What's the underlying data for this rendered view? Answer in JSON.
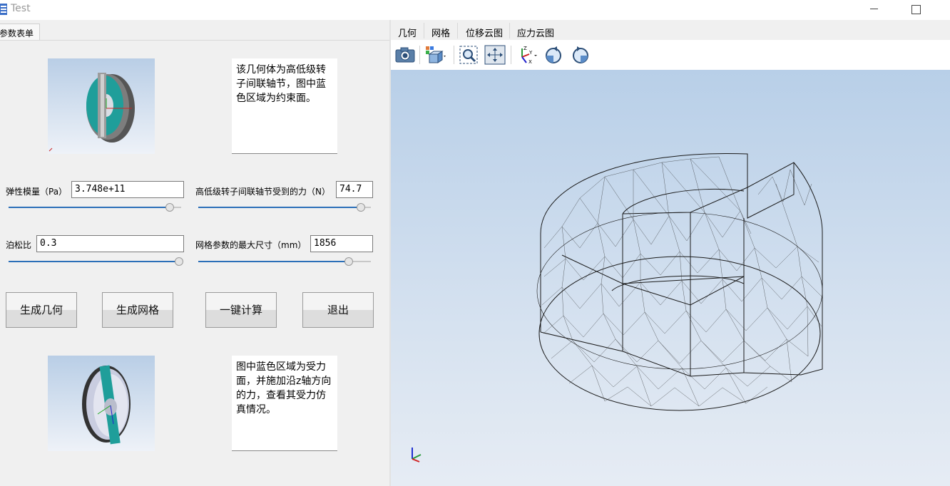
{
  "window": {
    "title": "Test"
  },
  "left_tab": {
    "label": "参数表单"
  },
  "top_section": {
    "description": "该几何体为高低级转子间联轴节，图中蓝色区域为约束面。"
  },
  "fields": {
    "modulus": {
      "label": "弹性模量（Pa）",
      "value": "3.748e+11",
      "slider_fraction": 0.93
    },
    "force": {
      "label": "高低级转子间联轴节受到的力（N）",
      "value": "74.7",
      "slider_fraction": 0.93
    },
    "poisson": {
      "label": "泊松比",
      "value": "0.3",
      "slider_fraction": 1.0
    },
    "mesh_size": {
      "label": "网格参数的最大尺寸（mm）",
      "value": "1856",
      "slider_fraction": 0.87
    }
  },
  "buttons": {
    "gen_geometry": "生成几何",
    "gen_mesh": "生成网格",
    "compute": "一键计算",
    "exit": "退出"
  },
  "bottom_section": {
    "description": "图中蓝色区域为受力面，并施加沿z轴方向的力，查看其受力仿真情况。"
  },
  "menu": {
    "items": [
      "几何",
      "网格",
      "位移云图",
      "应力云图"
    ]
  },
  "toolbar": {
    "icons": [
      "camera-icon",
      "view-cube-icon",
      "zoom-box-icon",
      "fit-view-icon",
      "axes-orientation-icon",
      "rotate-cw-icon",
      "rotate-ccw-icon"
    ],
    "axis_labels": {
      "z": "Z",
      "y": "Y",
      "x": "X"
    }
  },
  "colors": {
    "accent": "#2b6fb8",
    "teal": "#1f9e9a",
    "viewport_top": "#b8cfe8"
  }
}
